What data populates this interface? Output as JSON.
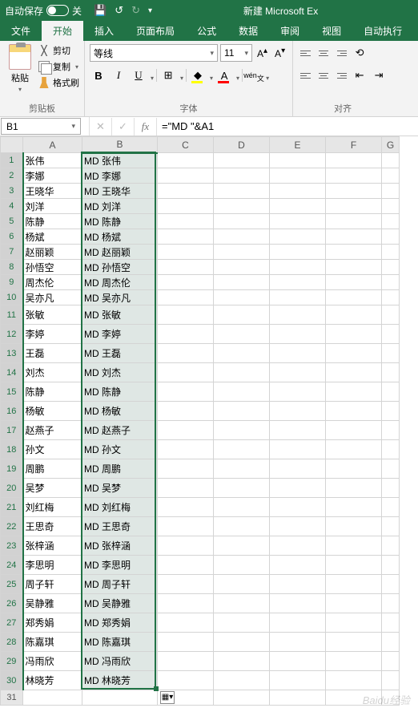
{
  "titlebar": {
    "autosave_label": "自动保存",
    "autosave_state": "关",
    "doc_title": "新建 Microsoft Ex"
  },
  "tabs": [
    "文件",
    "开始",
    "插入",
    "页面布局",
    "公式",
    "数据",
    "审阅",
    "视图",
    "自动执行"
  ],
  "active_tab_index": 1,
  "clipboard": {
    "paste": "粘贴",
    "cut": "剪切",
    "copy": "复制",
    "format_painter": "格式刷",
    "group_label": "剪贴板"
  },
  "font": {
    "name": "等线",
    "size": "11",
    "group_label": "字体",
    "wen_label": "wén"
  },
  "alignment": {
    "group_label": "对齐"
  },
  "namebox": "B1",
  "formula": "=\"MD \"&A1",
  "columns": [
    "A",
    "B",
    "C",
    "D",
    "E",
    "F",
    "G"
  ],
  "rows": [
    {
      "n": 1,
      "a": "张伟",
      "b": "MD 张伟"
    },
    {
      "n": 2,
      "a": "李娜",
      "b": "MD 李娜"
    },
    {
      "n": 3,
      "a": "王晓华",
      "b": "MD 王晓华"
    },
    {
      "n": 4,
      "a": "刘洋",
      "b": "MD 刘洋"
    },
    {
      "n": 5,
      "a": "陈静",
      "b": "MD 陈静"
    },
    {
      "n": 6,
      "a": "杨斌",
      "b": "MD 杨斌"
    },
    {
      "n": 7,
      "a": "赵丽颖",
      "b": "MD 赵丽颖"
    },
    {
      "n": 8,
      "a": "孙悟空",
      "b": "MD 孙悟空"
    },
    {
      "n": 9,
      "a": "周杰伦",
      "b": "MD 周杰伦"
    },
    {
      "n": 10,
      "a": "吴亦凡",
      "b": "MD 吴亦凡"
    },
    {
      "n": 11,
      "a": "张敏",
      "b": "MD 张敏",
      "tall": true
    },
    {
      "n": 12,
      "a": "李婷",
      "b": "MD 李婷",
      "tall": true
    },
    {
      "n": 13,
      "a": "王磊",
      "b": "MD 王磊",
      "tall": true
    },
    {
      "n": 14,
      "a": "刘杰",
      "b": "MD 刘杰",
      "tall": true
    },
    {
      "n": 15,
      "a": "陈静",
      "b": "MD 陈静",
      "tall": true
    },
    {
      "n": 16,
      "a": "杨敏",
      "b": "MD 杨敏",
      "tall": true
    },
    {
      "n": 17,
      "a": "赵燕子",
      "b": "MD 赵燕子",
      "tall": true
    },
    {
      "n": 18,
      "a": " 孙文",
      "b": "MD  孙文",
      "tall": true
    },
    {
      "n": 19,
      "a": "周鹏",
      "b": "MD 周鹏",
      "tall": true
    },
    {
      "n": 20,
      "a": "吴梦",
      "b": "MD 吴梦",
      "tall": true
    },
    {
      "n": 21,
      "a": "刘红梅",
      "b": "MD 刘红梅",
      "tall": true
    },
    {
      "n": 22,
      "a": "王思奇",
      "b": "MD 王思奇",
      "tall": true
    },
    {
      "n": 23,
      "a": "张梓涵",
      "b": "MD 张梓涵",
      "tall": true
    },
    {
      "n": 24,
      "a": "李思明",
      "b": "MD 李思明",
      "tall": true
    },
    {
      "n": 25,
      "a": "周子轩",
      "b": "MD 周子轩",
      "tall": true
    },
    {
      "n": 26,
      "a": "吴静雅",
      "b": "MD 吴静雅",
      "tall": true
    },
    {
      "n": 27,
      "a": "郑秀娟",
      "b": "MD 郑秀娟",
      "tall": true
    },
    {
      "n": 28,
      "a": "陈嘉琪",
      "b": "MD 陈嘉琪",
      "tall": true
    },
    {
      "n": 29,
      "a": "冯雨欣",
      "b": "MD 冯雨欣",
      "tall": true
    },
    {
      "n": 30,
      "a": "林晓芳",
      "b": "MD 林晓芳",
      "tall": true
    },
    {
      "n": 31,
      "a": "",
      "b": ""
    }
  ],
  "watermark": "Baidu经验"
}
